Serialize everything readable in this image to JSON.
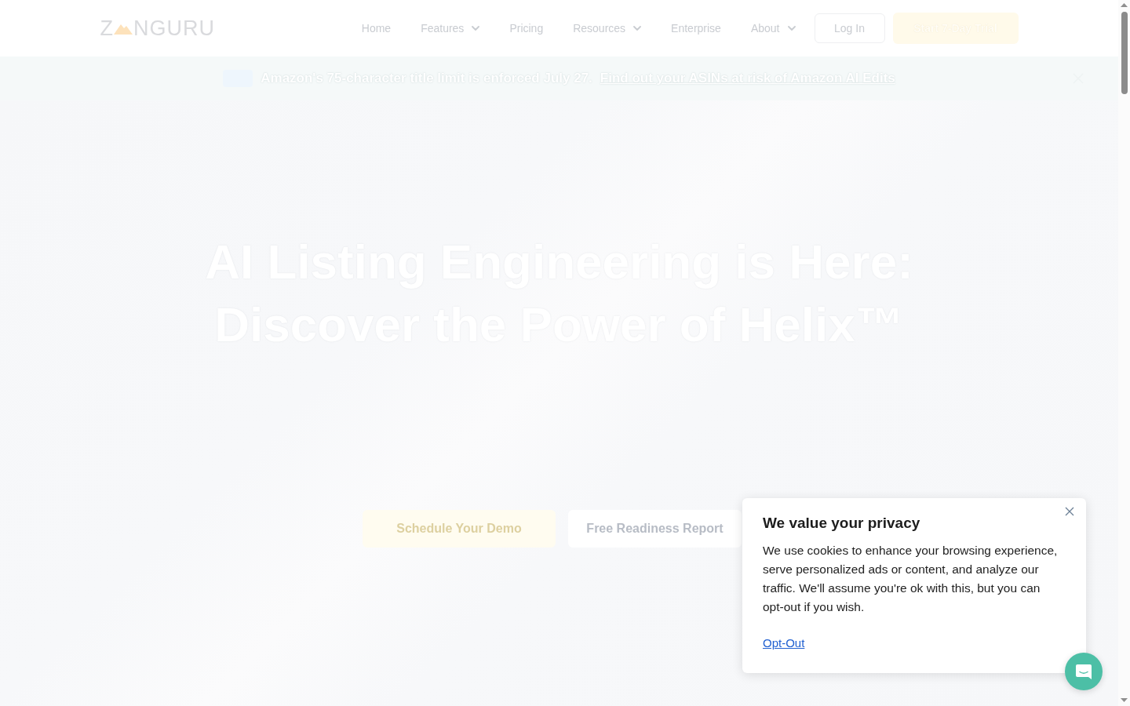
{
  "header": {
    "logo": {
      "text_start": "Z",
      "text_end": "NGURU"
    },
    "nav": [
      {
        "label": "Home",
        "has_menu": false
      },
      {
        "label": "Features",
        "has_menu": true
      },
      {
        "label": "Pricing",
        "has_menu": false
      },
      {
        "label": "Resources",
        "has_menu": true
      },
      {
        "label": "Enterprise",
        "has_menu": false
      },
      {
        "label": "About",
        "has_menu": true
      }
    ],
    "login_button": "Log In",
    "trial_button": "Start 7-Day Trial"
  },
  "announcement": {
    "text": "Amazon's 75-character title limit is enforced July 27.",
    "link": "Find out your ASINs at risk of Amazon AI Edits"
  },
  "hero": {
    "title_lines": [
      "AI Listing Engineering is Here:",
      "Discover the Power of Helix™"
    ],
    "buttons": [
      {
        "label": "Schedule Your Demo",
        "kind": "primary"
      },
      {
        "label": "Free Readiness Report",
        "kind": "secondary"
      }
    ]
  },
  "cookie_notice": {
    "title": "We value your privacy",
    "body": "We use cookies to enhance your browsing experience, serve personalized ads or content, and analyze our traffic. We'll assume you're ok with this, but you can opt-out if you wish.",
    "link": "Opt-Out"
  }
}
